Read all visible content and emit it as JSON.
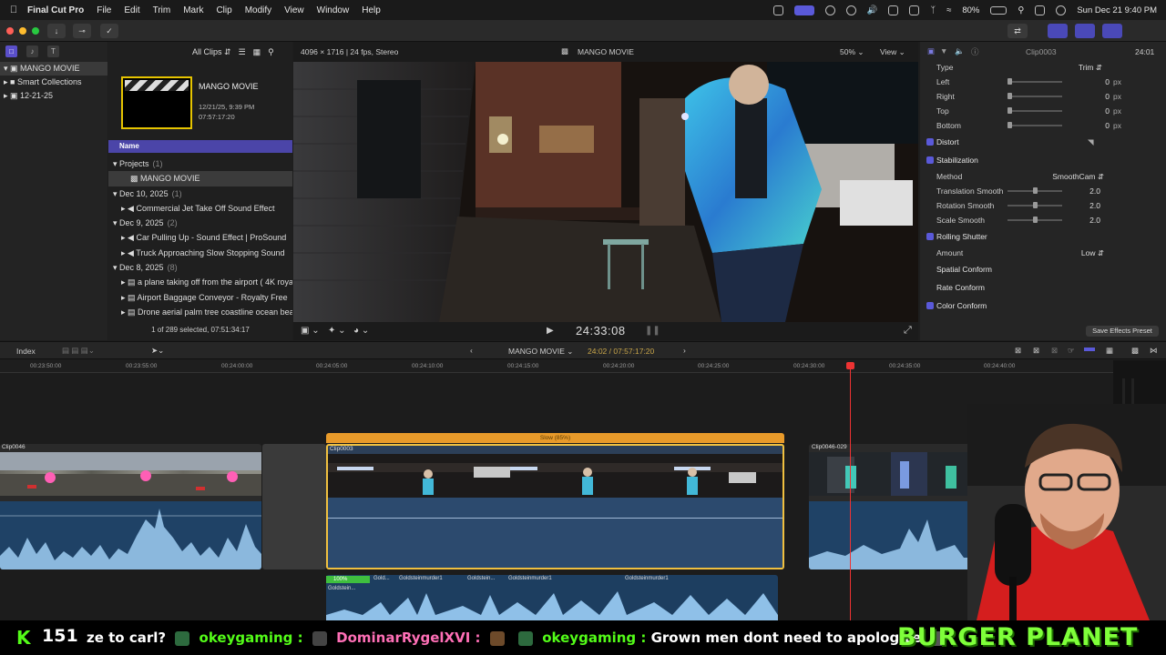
{
  "menubar": {
    "app_name": "Final Cut Pro",
    "items": [
      "File",
      "Edit",
      "Trim",
      "Mark",
      "Clip",
      "Modify",
      "View",
      "Window",
      "Help"
    ],
    "battery": "80%",
    "datetime": "Sun Dec 21  9:40 PM"
  },
  "sidebar": {
    "library": "MANGO MOVIE",
    "items": [
      {
        "label": "Smart Collections"
      },
      {
        "label": "12-21-25"
      }
    ]
  },
  "browser": {
    "filter": "All Clips",
    "project_title": "MANGO MOVIE",
    "project_date": "12/21/25, 9:39 PM",
    "project_duration": "07:57:17:20",
    "column_name": "Name",
    "rows": [
      {
        "label": "Projects",
        "count": "(1)"
      },
      {
        "label": "MANGO MOVIE",
        "count": ""
      },
      {
        "label": "Dec 10, 2025",
        "count": "(1)"
      },
      {
        "label": "Commercial Jet Take Off Sound Effect",
        "count": ""
      },
      {
        "label": "Dec 9, 2025",
        "count": "(2)"
      },
      {
        "label": "Car Pulling Up - Sound Effect  |  ProSound",
        "count": ""
      },
      {
        "label": "Truck Approaching Slow Stopping Sound",
        "count": ""
      },
      {
        "label": "Dec 8, 2025",
        "count": "(8)"
      },
      {
        "label": "a plane taking off from the airport ( 4K royalty",
        "count": ""
      },
      {
        "label": "Airport Baggage Conveyor - Royalty Free",
        "count": ""
      },
      {
        "label": "Drone aerial palm tree coastline ocean beach",
        "count": ""
      }
    ],
    "footer": "1 of 289 selected, 07:51:34:17"
  },
  "viewer": {
    "format": "4096 × 1716 | 24 fps, Stereo",
    "title": "MANGO MOVIE",
    "zoom": "50%",
    "view_label": "View",
    "timecode": "24:33:08"
  },
  "inspector": {
    "clip_name": "Clip0003",
    "duration": "24:01",
    "crop_type_label": "Type",
    "crop_type_value": "Trim",
    "crop_rows": [
      {
        "label": "Left",
        "value": "0",
        "unit": "px",
        "level": 0.0
      },
      {
        "label": "Right",
        "value": "0",
        "unit": "px",
        "level": 0.0
      },
      {
        "label": "Top",
        "value": "0",
        "unit": "px",
        "level": 0.0
      },
      {
        "label": "Bottom",
        "value": "0",
        "unit": "px",
        "level": 0.0
      }
    ],
    "distort": "Distort",
    "stabilization": "Stabilization",
    "method_label": "Method",
    "method_value": "SmoothCam",
    "stab_rows": [
      {
        "label": "Translation Smooth",
        "value": "2.0",
        "level": 0.5
      },
      {
        "label": "Rotation Smooth",
        "value": "2.0",
        "level": 0.5
      },
      {
        "label": "Scale Smooth",
        "value": "2.0",
        "level": 0.5
      }
    ],
    "rolling_shutter": "Rolling Shutter",
    "amount_label": "Amount",
    "amount_value": "Low",
    "spatial_conform": "Spatial Conform",
    "rate_conform": "Rate Conform",
    "color_conform": "Color Conform",
    "save_preset": "Save Effects Preset"
  },
  "timeline": {
    "index_label": "Index",
    "project": "MANGO MOVIE",
    "position": "24:02 / 07:57:17:20",
    "ruler": [
      "00:23:50:00",
      "00:23:55:00",
      "00:24:00:00",
      "00:24:05:00",
      "00:24:10:00",
      "00:24:15:00",
      "00:24:20:00",
      "00:24:25:00",
      "00:24:30:00",
      "00:24:35:00",
      "00:24:40:00"
    ],
    "clips": [
      {
        "name": "Clip0046"
      },
      {
        "name": "Clip0003",
        "retime": "Slow (85%)"
      },
      {
        "name": "Clip0046-029"
      }
    ],
    "audio_clips": [
      "100%",
      "Gold...",
      "Goldsteinmurder1",
      "Goldstein...",
      "Goldsteinmurder1",
      "Goldsteinmurder1"
    ],
    "audio_sub": "Goldstein..."
  },
  "overlay": {
    "viewer_count": "151",
    "chat": [
      {
        "text": "ze to carl?",
        "user": ""
      },
      {
        "text": "",
        "user": "okeygaming :"
      },
      {
        "text": "",
        "user": "DominarRygelXVI :"
      },
      {
        "text": "Grown men dont need to apologize",
        "user": "okeygaming :"
      }
    ],
    "banner": "BURGER PLANET"
  }
}
